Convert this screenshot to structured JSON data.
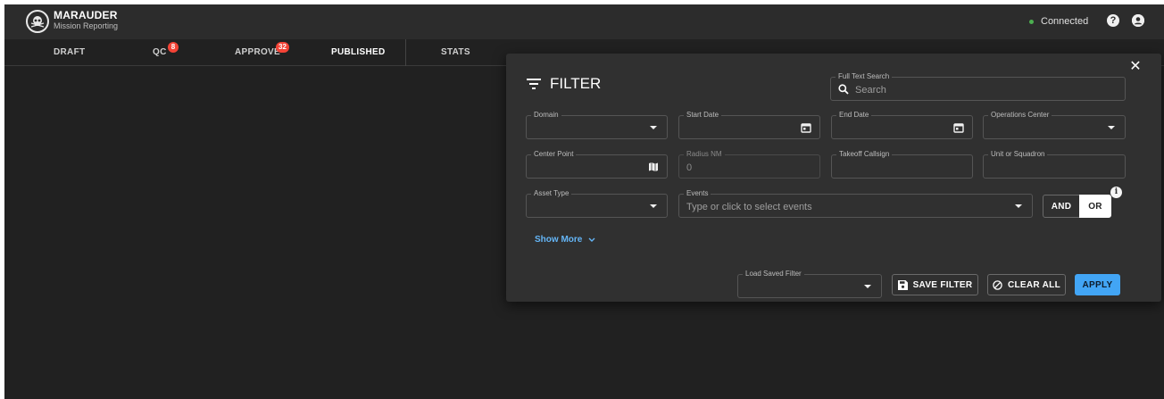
{
  "app": {
    "title": "MARAUDER",
    "subtitle": "Mission Reporting"
  },
  "status": {
    "label": "Connected",
    "color": "#4caf50"
  },
  "header_icons": [
    "help-icon",
    "account-icon"
  ],
  "tabs": [
    {
      "label": "DRAFT",
      "badge": ""
    },
    {
      "label": "QC",
      "badge": "8"
    },
    {
      "label": "APPROVE",
      "badge": "32"
    },
    {
      "label": "PUBLISHED",
      "badge": ""
    },
    {
      "label": "STATS",
      "badge": ""
    }
  ],
  "filter": {
    "title": "FILTER",
    "search": {
      "label": "Full Text Search",
      "placeholder": "Search"
    },
    "domain": {
      "label": "Domain",
      "value": ""
    },
    "start_date": {
      "label": "Start Date",
      "value": ""
    },
    "end_date": {
      "label": "End Date",
      "value": ""
    },
    "operations_center": {
      "label": "Operations Center",
      "value": ""
    },
    "center_point": {
      "label": "Center Point",
      "value": ""
    },
    "radius": {
      "label": "Radius NM",
      "value": "0"
    },
    "takeoff_callsign": {
      "label": "Takeoff Callsign",
      "value": ""
    },
    "unit_squadron": {
      "label": "Unit or Squadron",
      "value": ""
    },
    "asset_type": {
      "label": "Asset Type",
      "value": ""
    },
    "events": {
      "label": "Events",
      "placeholder": "Type or click to select events"
    },
    "logic": {
      "and_label": "AND",
      "or_label": "OR",
      "selected": "OR"
    },
    "show_more": "Show More",
    "load_saved": {
      "label": "Load Saved Filter",
      "value": ""
    },
    "save_label": "SAVE FILTER",
    "clear_label": "CLEAR ALL",
    "apply_label": "APPLY",
    "accent_color": "#42a5f5"
  }
}
